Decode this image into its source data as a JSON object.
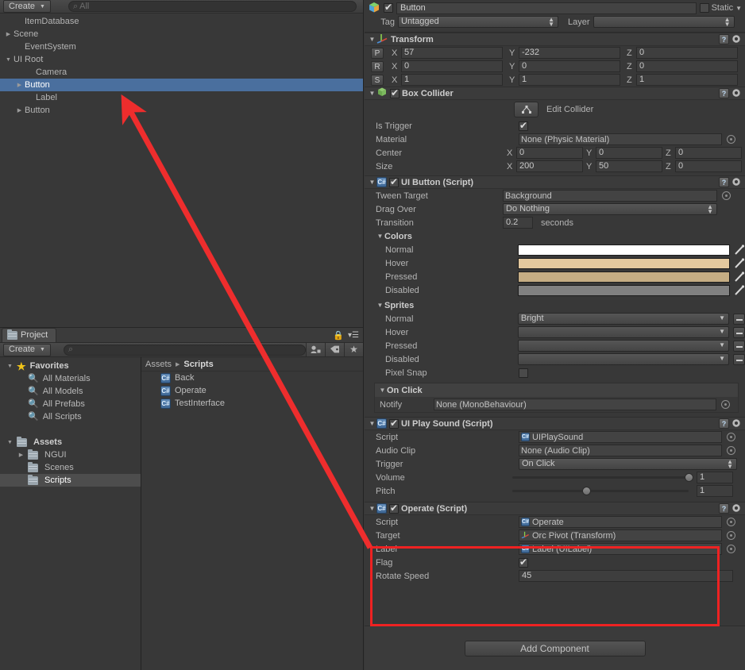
{
  "hierarchy": {
    "create_label": "Create",
    "search_placeholder": "All",
    "items": [
      {
        "label": "ItemDatabase",
        "indent": 1,
        "arrow": "none",
        "selected": false
      },
      {
        "label": "Scene",
        "indent": 0,
        "arrow": "collapsed",
        "selected": false
      },
      {
        "label": "EventSystem",
        "indent": 1,
        "arrow": "none",
        "selected": false
      },
      {
        "label": "UI Root",
        "indent": 0,
        "arrow": "expanded",
        "selected": false
      },
      {
        "label": "Camera",
        "indent": 2,
        "arrow": "none",
        "selected": false
      },
      {
        "label": "Button",
        "indent": 1,
        "arrow": "collapsed",
        "selected": true
      },
      {
        "label": "Label",
        "indent": 2,
        "arrow": "none",
        "selected": false
      },
      {
        "label": "Button",
        "indent": 1,
        "arrow": "collapsed",
        "selected": false
      }
    ]
  },
  "project": {
    "tab_label": "Project",
    "create_label": "Create",
    "search_placeholder": "",
    "tree": [
      {
        "label": "Favorites",
        "icon": "star",
        "indent": 0,
        "arrow": "expanded",
        "bold": true,
        "selected": false
      },
      {
        "label": "All Materials",
        "icon": "search",
        "indent": 1,
        "arrow": "none",
        "bold": false,
        "selected": false
      },
      {
        "label": "All Models",
        "icon": "search",
        "indent": 1,
        "arrow": "none",
        "bold": false,
        "selected": false
      },
      {
        "label": "All Prefabs",
        "icon": "search",
        "indent": 1,
        "arrow": "none",
        "bold": false,
        "selected": false
      },
      {
        "label": "All Scripts",
        "icon": "search",
        "indent": 1,
        "arrow": "none",
        "bold": false,
        "selected": false
      },
      {
        "label": "",
        "icon": "none",
        "indent": 0,
        "arrow": "none",
        "bold": false,
        "selected": false
      },
      {
        "label": "Assets",
        "icon": "folder",
        "indent": 0,
        "arrow": "expanded",
        "bold": true,
        "selected": false
      },
      {
        "label": "NGUI",
        "icon": "folder",
        "indent": 1,
        "arrow": "collapsed",
        "bold": false,
        "selected": false
      },
      {
        "label": "Scenes",
        "icon": "folder",
        "indent": 1,
        "arrow": "none",
        "bold": false,
        "selected": false
      },
      {
        "label": "Scripts",
        "icon": "folder",
        "indent": 1,
        "arrow": "none",
        "bold": false,
        "selected": true
      }
    ],
    "breadcrumb_root": "Assets",
    "breadcrumb_current": "Scripts",
    "assets": [
      {
        "label": "Back",
        "icon": "cs-script"
      },
      {
        "label": "Operate",
        "icon": "cs-script"
      },
      {
        "label": "TestInterface",
        "icon": "cs-script"
      }
    ]
  },
  "inspector": {
    "object_name": "Button",
    "object_enabled": true,
    "static_label": "Static",
    "static_checked": false,
    "tag_label": "Tag",
    "tag_value": "Untagged",
    "layer_label": "Layer",
    "layer_value": "",
    "transform": {
      "title": "Transform",
      "rows": [
        {
          "prefix": "P",
          "x": "57",
          "y": "-232",
          "z": "0"
        },
        {
          "prefix": "R",
          "x": "0",
          "y": "0",
          "z": "0"
        },
        {
          "prefix": "S",
          "x": "1",
          "y": "1",
          "z": "1"
        }
      ],
      "axis_labels": [
        "X",
        "Y",
        "Z"
      ]
    },
    "box_collider": {
      "title": "Box Collider",
      "enabled": true,
      "edit_collider_label": "Edit Collider",
      "is_trigger_label": "Is Trigger",
      "is_trigger": true,
      "material_label": "Material",
      "material_value": "None (Physic Material)",
      "center_label": "Center",
      "center": {
        "x": "0",
        "y": "0",
        "z": "0"
      },
      "size_label": "Size",
      "size": {
        "x": "200",
        "y": "50",
        "z": "0"
      }
    },
    "ui_button": {
      "title": "UI Button (Script)",
      "enabled": true,
      "tween_target_label": "Tween Target",
      "tween_target_value": "Background",
      "drag_over_label": "Drag Over",
      "drag_over_value": "Do Nothing",
      "transition_label": "Transition",
      "transition_value": "0.2",
      "transition_units": "seconds",
      "colors_label": "Colors",
      "colors": [
        {
          "label": "Normal",
          "hex": "#ffffff"
        },
        {
          "label": "Hover",
          "hex": "#e3c89e"
        },
        {
          "label": "Pressed",
          "hex": "#c5ad84"
        },
        {
          "label": "Disabled",
          "hex": "#808080"
        }
      ],
      "sprites_label": "Sprites",
      "sprites": [
        {
          "label": "Normal",
          "value": "Bright"
        },
        {
          "label": "Hover",
          "value": ""
        },
        {
          "label": "Pressed",
          "value": ""
        },
        {
          "label": "Disabled",
          "value": ""
        }
      ],
      "pixel_snap_label": "Pixel Snap",
      "pixel_snap": false,
      "on_click_label": "On Click",
      "notify_label": "Notify",
      "notify_value": "None (MonoBehaviour)"
    },
    "ui_play_sound": {
      "title": "UI Play Sound (Script)",
      "enabled": true,
      "script_label": "Script",
      "script_value": "UIPlaySound",
      "audio_clip_label": "Audio Clip",
      "audio_clip_value": "None (Audio Clip)",
      "trigger_label": "Trigger",
      "trigger_value": "On Click",
      "volume_label": "Volume",
      "volume_value": "1",
      "volume_pct": 100,
      "pitch_label": "Pitch",
      "pitch_value": "1",
      "pitch_pct": 42
    },
    "operate": {
      "title": "Operate (Script)",
      "enabled": true,
      "highlighted": true,
      "script_label": "Script",
      "script_value": "Operate",
      "target_label": "Target",
      "target_value": "Orc Pivot (Transform)",
      "label_label": "Label",
      "label_value": "Label (UILabel)",
      "flag_label": "Flag",
      "flag_checked": true,
      "rotate_speed_label": "Rotate Speed",
      "rotate_speed_value": "45"
    },
    "add_component_label": "Add Component"
  },
  "annotation": {
    "arrow_color": "#ee2d2d",
    "highlight_color": "#ee2222"
  }
}
